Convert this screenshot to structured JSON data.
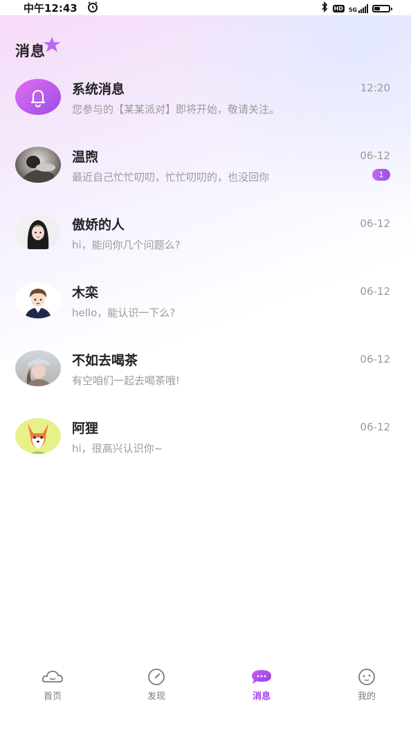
{
  "status_bar": {
    "time": "中午12:43",
    "hd": "HD",
    "network": "5G"
  },
  "header": {
    "title": "消息"
  },
  "conversations": [
    {
      "name": "系统消息",
      "time": "12:20",
      "preview": "您参与的【某某派对】即将开始，敬请关注。",
      "badge": ""
    },
    {
      "name": "温煦",
      "time": "06-12",
      "preview": "最近自己忙忙叨叨，忙忙叨叨的，也没回你",
      "badge": "1"
    },
    {
      "name": "傲娇的人",
      "time": "06-12",
      "preview": "hi，能问你几个问题么?",
      "badge": ""
    },
    {
      "name": "木栾",
      "time": "06-12",
      "preview": "hello，能认识一下么?",
      "badge": ""
    },
    {
      "name": "不如去喝茶",
      "time": "06-12",
      "preview": "有空咱们一起去喝茶哦!",
      "badge": ""
    },
    {
      "name": "阿狸",
      "time": "06-12",
      "preview": "hi，很高兴认识你~",
      "badge": ""
    }
  ],
  "tabs": [
    {
      "label": "首页",
      "icon": "home-cloud-icon",
      "active": false
    },
    {
      "label": "发现",
      "icon": "compass-icon",
      "active": false
    },
    {
      "label": "消息",
      "icon": "chat-bubble-icon",
      "active": true
    },
    {
      "label": "我的",
      "icon": "profile-face-icon",
      "active": false
    }
  ],
  "colors": {
    "accent": "#a23cf0",
    "badge": "#b15cee",
    "muted_text": "#9a9a9a"
  }
}
